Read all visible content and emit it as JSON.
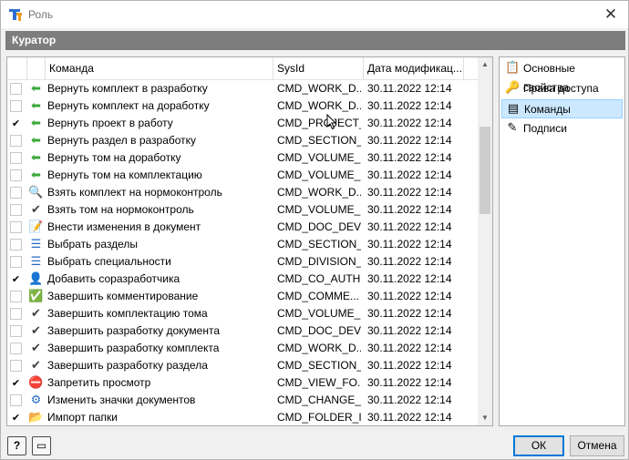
{
  "window": {
    "title": "Роль",
    "close_glyph": "✕",
    "app_icon": "app-logo-icon"
  },
  "header": {
    "title": "Куратор"
  },
  "grid": {
    "columns": [
      "Команда",
      "SysId",
      "Дата модификац..."
    ],
    "rows": [
      {
        "checked": false,
        "check_mark": "",
        "icon": "green-arrow-left-icon",
        "glyph": "⬅",
        "color": "#3aa83a",
        "name": "Вернуть комплект в разработку",
        "sysid": "CMD_WORK_D...",
        "date": "30.11.2022 12:14"
      },
      {
        "checked": false,
        "check_mark": "",
        "icon": "green-arrow-left-icon",
        "glyph": "⬅",
        "color": "#3aa83a",
        "name": "Вернуть комплект на доработку",
        "sysid": "CMD_WORK_D...",
        "date": "30.11.2022 12:14"
      },
      {
        "checked": true,
        "check_mark": "✔",
        "icon": "green-arrow-left-icon",
        "glyph": "⬅",
        "color": "#3aa83a",
        "name": "Вернуть проект в работу",
        "sysid": "CMD_PROJECT_...",
        "date": "30.11.2022 12:14"
      },
      {
        "checked": false,
        "check_mark": "",
        "icon": "green-arrow-left-icon",
        "glyph": "⬅",
        "color": "#3aa83a",
        "name": "Вернуть раздел в разработку",
        "sysid": "CMD_SECTION_...",
        "date": "30.11.2022 12:14"
      },
      {
        "checked": false,
        "check_mark": "",
        "icon": "green-arrow-left-icon",
        "glyph": "⬅",
        "color": "#3aa83a",
        "name": "Вернуть том на доработку",
        "sysid": "CMD_VOLUME_...",
        "date": "30.11.2022 12:14"
      },
      {
        "checked": false,
        "check_mark": "",
        "icon": "green-arrow-left-icon",
        "glyph": "⬅",
        "color": "#3aa83a",
        "name": "Вернуть том на комплектацию",
        "sysid": "CMD_VOLUME_...",
        "date": "30.11.2022 12:14"
      },
      {
        "checked": false,
        "check_mark": "",
        "icon": "document-search-icon",
        "glyph": "🔍",
        "color": "#2a6cc4",
        "name": "Взять комплект на нормоконтроль",
        "sysid": "CMD_WORK_D...",
        "date": "30.11.2022 12:14"
      },
      {
        "checked": false,
        "check_mark": "",
        "icon": "checkmark-icon",
        "glyph": "✔",
        "color": "#404040",
        "name": "Взять том на нормоконтроль",
        "sysid": "CMD_VOLUME_...",
        "date": "30.11.2022 12:14"
      },
      {
        "checked": false,
        "check_mark": "",
        "icon": "document-edit-icon",
        "glyph": "📝",
        "color": "#c47a1a",
        "name": "Внести изменения в документ",
        "sysid": "CMD_DOC_DEV...",
        "date": "30.11.2022 12:14"
      },
      {
        "checked": false,
        "check_mark": "",
        "icon": "list-tree-icon",
        "glyph": "☰",
        "color": "#2a6cc4",
        "name": "Выбрать разделы",
        "sysid": "CMD_SECTION_...",
        "date": "30.11.2022 12:14"
      },
      {
        "checked": false,
        "check_mark": "",
        "icon": "list-tree-icon",
        "glyph": "☰",
        "color": "#2a6cc4",
        "name": "Выбрать специальности",
        "sysid": "CMD_DIVISION_...",
        "date": "30.11.2022 12:14"
      },
      {
        "checked": true,
        "check_mark": "✔",
        "icon": "user-icon",
        "glyph": "👤",
        "color": "#505050",
        "name": "Добавить соразработчика",
        "sysid": "CMD_CO_AUTH...",
        "date": "30.11.2022 12:14"
      },
      {
        "checked": false,
        "check_mark": "",
        "icon": "document-check-icon",
        "glyph": "✅",
        "color": "#3aa83a",
        "name": "Завершить комментирование",
        "sysid": "CMD_COMME...",
        "date": "30.11.2022 12:14"
      },
      {
        "checked": false,
        "check_mark": "",
        "icon": "checkmark-icon",
        "glyph": "✔",
        "color": "#404040",
        "name": "Завершить комплектацию тома",
        "sysid": "CMD_VOLUME_...",
        "date": "30.11.2022 12:14"
      },
      {
        "checked": false,
        "check_mark": "",
        "icon": "checkmark-icon",
        "glyph": "✔",
        "color": "#404040",
        "name": "Завершить разработку документа",
        "sysid": "CMD_DOC_DEV...",
        "date": "30.11.2022 12:14"
      },
      {
        "checked": false,
        "check_mark": "",
        "icon": "checkmark-icon",
        "glyph": "✔",
        "color": "#404040",
        "name": "Завершить разработку комплекта",
        "sysid": "CMD_WORK_D...",
        "date": "30.11.2022 12:14"
      },
      {
        "checked": false,
        "check_mark": "",
        "icon": "checkmark-icon",
        "glyph": "✔",
        "color": "#404040",
        "name": "Завершить разработку раздела",
        "sysid": "CMD_SECTION_...",
        "date": "30.11.2022 12:14"
      },
      {
        "checked": true,
        "check_mark": "✔",
        "icon": "user-forbidden-icon",
        "glyph": "⛔",
        "color": "#d02020",
        "name": "Запретить просмотр",
        "sysid": "CMD_VIEW_FO...",
        "date": "30.11.2022 12:14"
      },
      {
        "checked": false,
        "check_mark": "",
        "icon": "document-settings-icon",
        "glyph": "⚙",
        "color": "#2a6cc4",
        "name": "Изменить значки документов",
        "sysid": "CMD_CHANGE_...",
        "date": "30.11.2022 12:14"
      },
      {
        "checked": true,
        "check_mark": "✔",
        "icon": "folder-import-icon",
        "glyph": "📂",
        "color": "#2a6cc4",
        "name": "Импорт папки",
        "sysid": "CMD_FOLDER_I...",
        "date": "30.11.2022 12:14"
      }
    ]
  },
  "scroll": {
    "up_arrow": "▲",
    "down_arrow": "▼"
  },
  "nav": {
    "items": [
      {
        "label": "Основные свойства",
        "icon": "properties-icon",
        "glyph": "📋",
        "selected": false
      },
      {
        "label": "Права доступа",
        "icon": "access-rights-icon",
        "glyph": "🔑",
        "selected": false
      },
      {
        "label": "Команды",
        "icon": "commands-icon",
        "glyph": "▤",
        "selected": true
      },
      {
        "label": "Подписи",
        "icon": "signature-icon",
        "glyph": "✎",
        "selected": false
      }
    ]
  },
  "footer": {
    "help_label": "?",
    "comment_glyph": "▭",
    "ok_label": "ОК",
    "cancel_label": "Отмена"
  }
}
